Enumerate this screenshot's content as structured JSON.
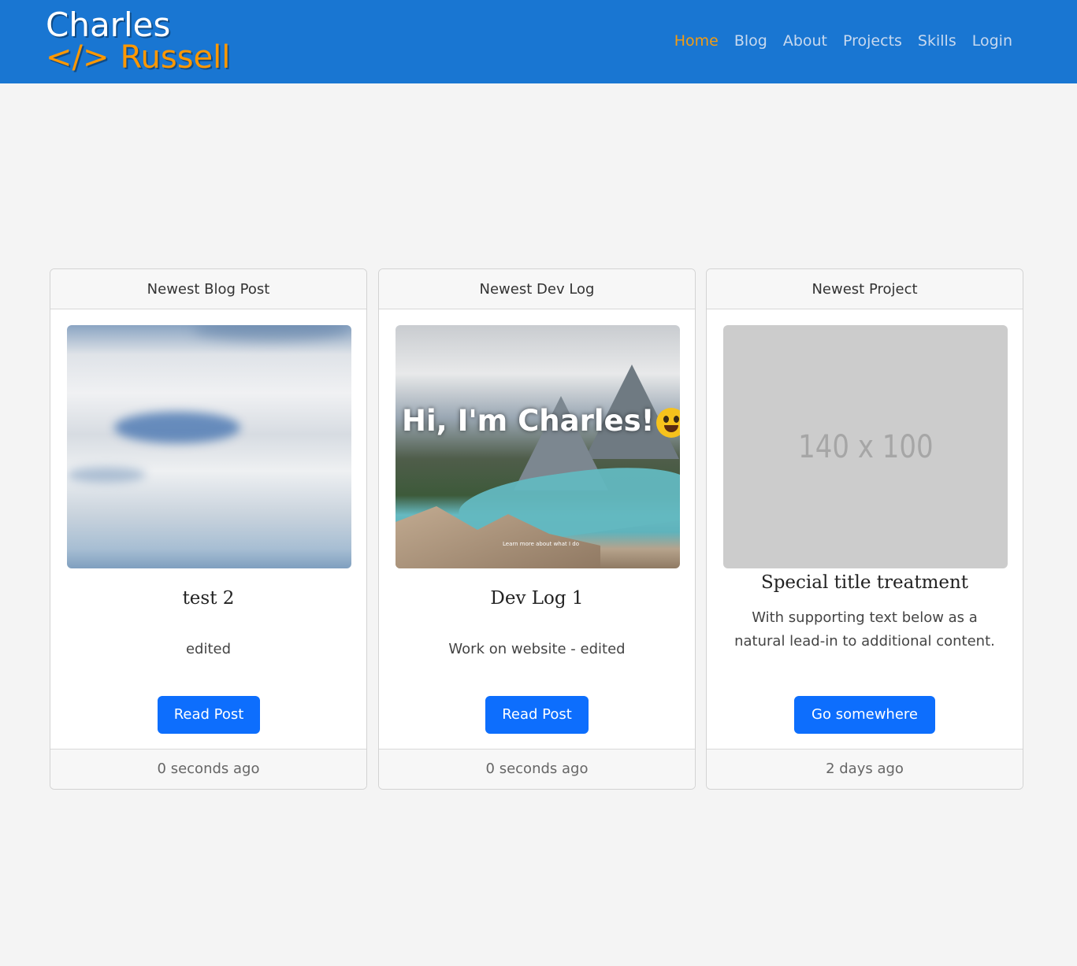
{
  "brand": {
    "line1": "Charles",
    "line2_code": "</>",
    "line2_name": "Russell"
  },
  "nav": {
    "items": [
      {
        "label": "Home",
        "active": true
      },
      {
        "label": "Blog",
        "active": false
      },
      {
        "label": "About",
        "active": false
      },
      {
        "label": "Projects",
        "active": false
      },
      {
        "label": "Skills",
        "active": false
      },
      {
        "label": "Login",
        "active": false
      }
    ]
  },
  "cards": [
    {
      "header": "Newest Blog Post",
      "title": "test 2",
      "text": "edited",
      "button": "Read Post",
      "footer": "0 seconds ago"
    },
    {
      "header": "Newest Dev Log",
      "title": "Dev Log 1",
      "text": "Work on website - edited",
      "button": "Read Post",
      "footer": "0 seconds ago",
      "image_overlay": "Hi, I'm Charles!",
      "image_small_text": "Learn more about what I do"
    },
    {
      "header": "Newest Project",
      "title": "Special title treatment",
      "text": "With supporting text below as a natural lead-in to additional content.",
      "button": "Go somewhere",
      "footer": "2 days ago",
      "placeholder_label": "140 x 100"
    }
  ],
  "colors": {
    "navbar": "#1976d2",
    "nav_active": "#f39c12",
    "nav_link": "#c8d9ef",
    "button": "#0d6efd",
    "brand_accent": "#ff9800"
  }
}
